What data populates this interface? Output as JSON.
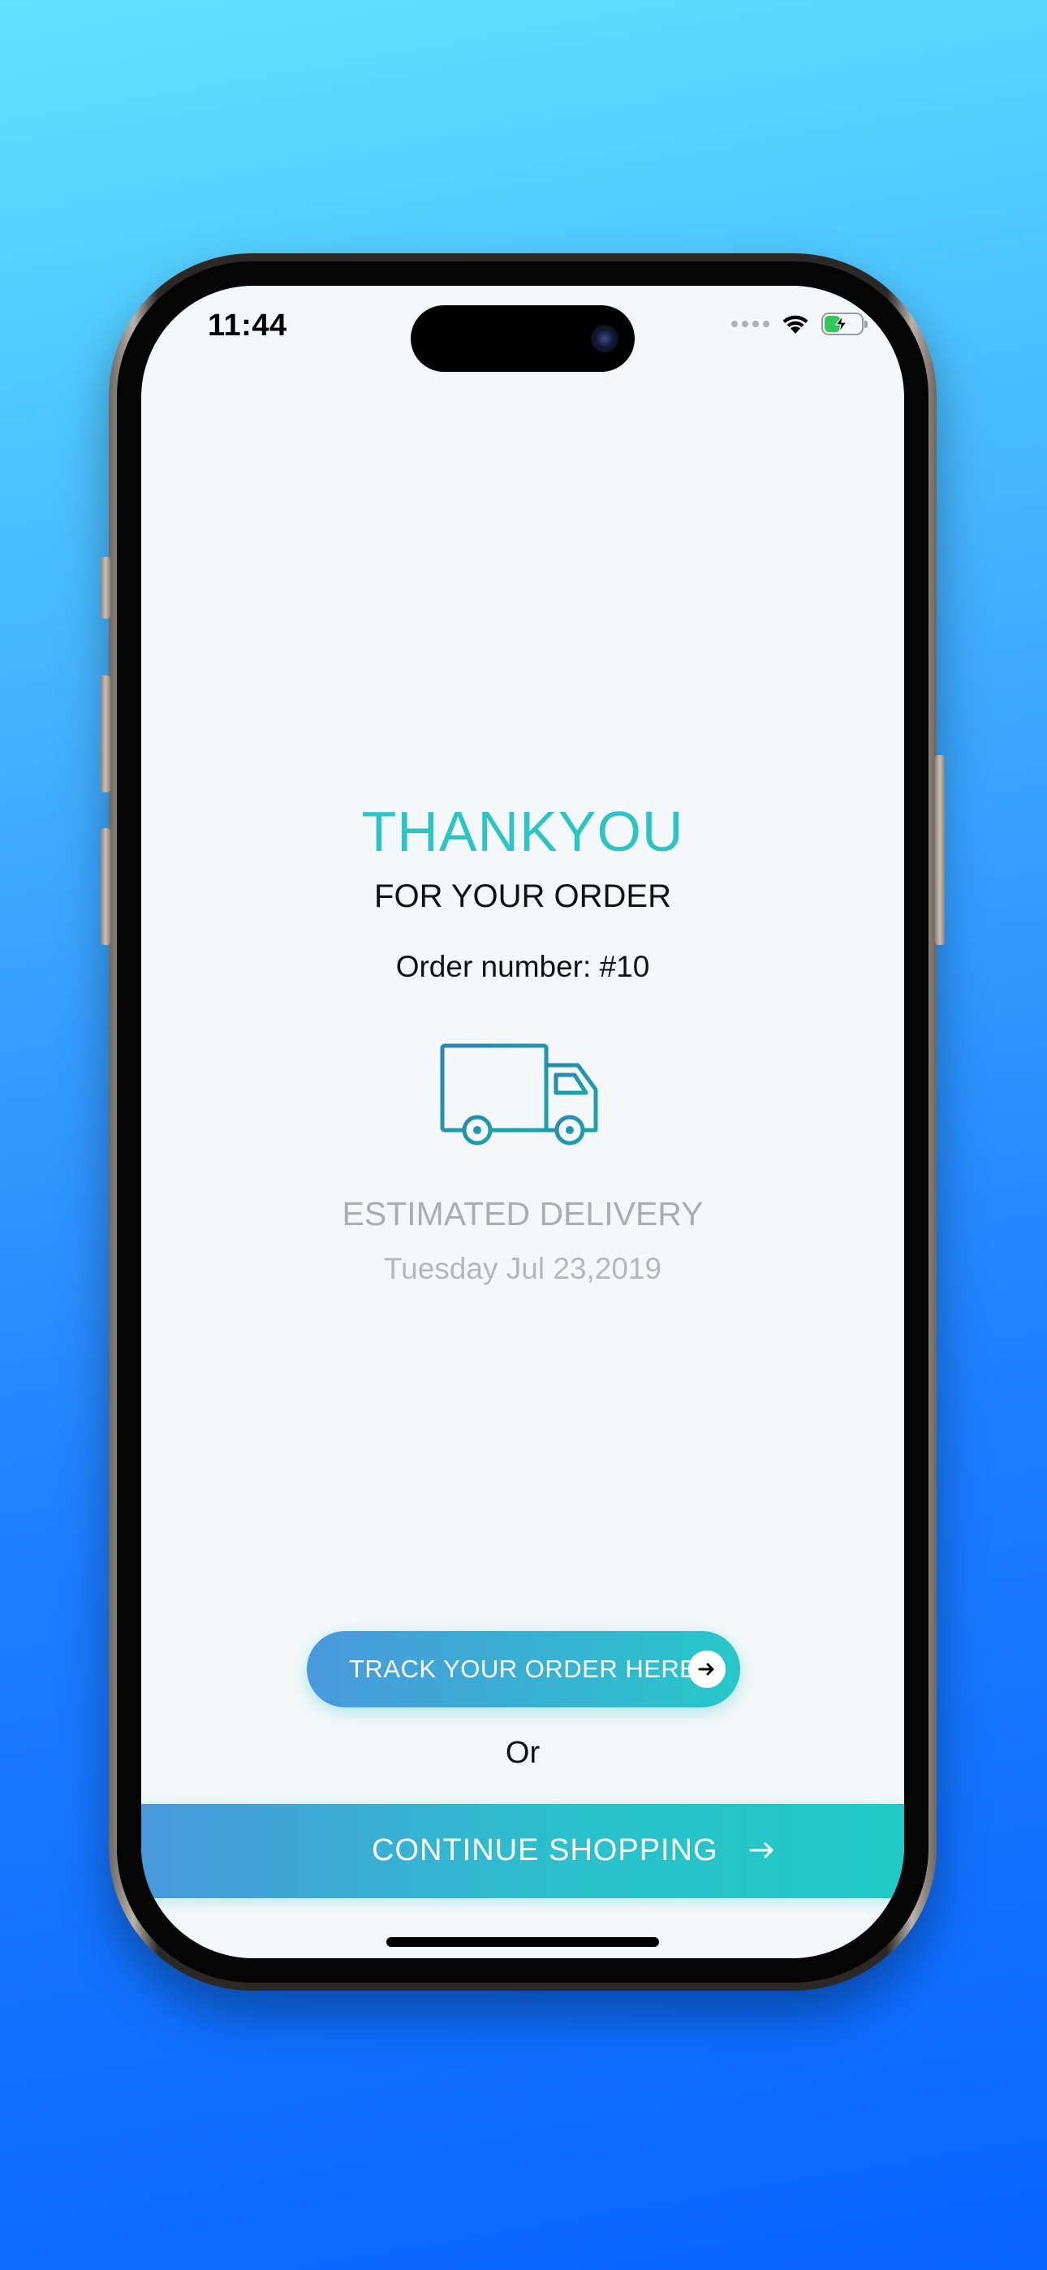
{
  "status_bar": {
    "time": "11:44",
    "battery_level": 0.45
  },
  "confirmation": {
    "title": "THANKYOU",
    "subtitle": "FOR YOUR ORDER",
    "order_number_text": "Order number: #10"
  },
  "delivery": {
    "label": "ESTIMATED DELIVERY",
    "date": "Tuesday Jul 23,2019"
  },
  "actions": {
    "track_label": "TRACK YOUR ORDER HERE",
    "or_text": "Or",
    "continue_label": "CONTINUE SHOPPING"
  },
  "icons": {
    "truck": "delivery-truck-icon",
    "track_arrow": "arrow-right-icon",
    "continue_arrow": "arrow-right-icon"
  },
  "colors": {
    "accent_teal": "#2ec4c4",
    "gradient_start": "#4a98dc",
    "gradient_end": "#28c7c9",
    "truck_stroke": "#1e8fa8",
    "muted_text": "#a9aeb3"
  }
}
